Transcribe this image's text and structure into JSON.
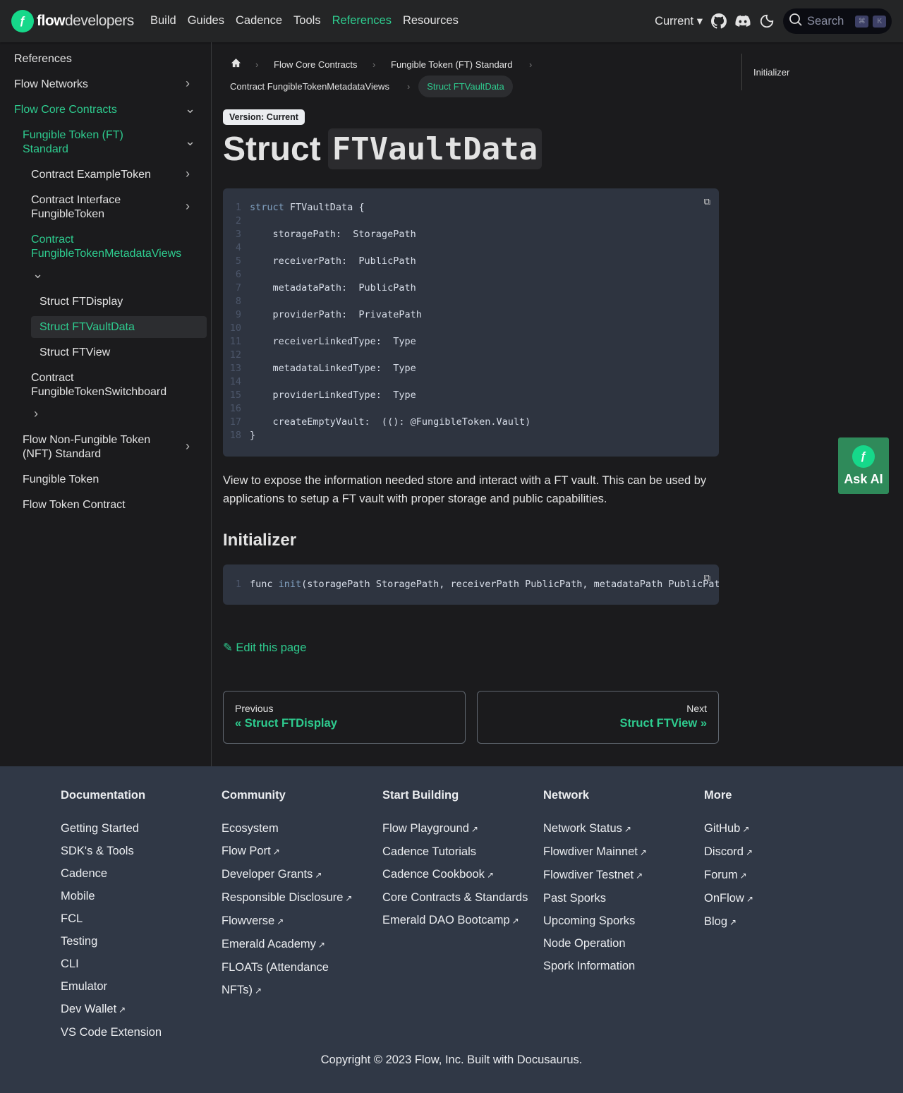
{
  "nav": {
    "logo_bold": "flow",
    "logo_rest": "developers",
    "links": [
      "Build",
      "Guides",
      "Cadence",
      "Tools",
      "References",
      "Resources"
    ],
    "active": "References",
    "version": "Current",
    "search_placeholder": "Search",
    "kbd1": "⌘",
    "kbd2": "K"
  },
  "sidebar": {
    "title": "References",
    "flow_networks": "Flow Networks",
    "flow_core": "Flow Core Contracts",
    "ft_standard": "Fungible Token (FT) Standard",
    "example_token": "Contract ExampleToken",
    "interface_ft": "Contract Interface FungibleToken",
    "ft_metadata": "Contract FungibleTokenMetadataViews",
    "ft_display": "Struct FTDisplay",
    "ft_vault_data": "Struct FTVaultData",
    "ft_view": "Struct FTView",
    "ft_switchboard": "Contract FungibleTokenSwitchboard",
    "nft_standard": "Flow Non-Fungible Token (NFT) Standard",
    "fungible_token": "Fungible Token",
    "flow_token": "Flow Token Contract"
  },
  "breadcrumb": [
    "Flow Core Contracts",
    "Fungible Token (FT) Standard",
    "Contract FungibleTokenMetadataViews",
    "Struct FTVaultData"
  ],
  "badge": "Version: Current",
  "title": {
    "prefix": "Struct",
    "code": "FTVaultData"
  },
  "code": [
    [
      "struct",
      " FTVaultData {"
    ],
    [
      "",
      ""
    ],
    [
      "",
      "    storagePath:  StoragePath"
    ],
    [
      "",
      ""
    ],
    [
      "",
      "    receiverPath:  PublicPath"
    ],
    [
      "",
      ""
    ],
    [
      "",
      "    metadataPath:  PublicPath"
    ],
    [
      "",
      ""
    ],
    [
      "",
      "    providerPath:  PrivatePath"
    ],
    [
      "",
      ""
    ],
    [
      "",
      "    receiverLinkedType:  Type"
    ],
    [
      "",
      ""
    ],
    [
      "",
      "    metadataLinkedType:  Type"
    ],
    [
      "",
      ""
    ],
    [
      "",
      "    providerLinkedType:  Type"
    ],
    [
      "",
      ""
    ],
    [
      "",
      "    createEmptyVault:  ((): @FungibleToken.Vault)"
    ],
    [
      "",
      "}"
    ]
  ],
  "description": "View to expose the information needed store and interact with a FT vault. This can be used by applications to setup a FT vault with proper storage and public capabilities.",
  "initializer": {
    "heading": "Initializer",
    "code_prefix": "func ",
    "code_fn": "init",
    "code_rest": "(storagePath StoragePath, receiverPath PublicPath, metadataPath PublicPath, providerPath PrivatePath"
  },
  "edit": "Edit this page",
  "pager": {
    "prev_sub": "Previous",
    "prev_label": "« Struct FTDisplay",
    "next_sub": "Next",
    "next_label": "Struct FTView »"
  },
  "toc": [
    "Initializer"
  ],
  "askai": "Ask AI",
  "footer": {
    "columns": [
      {
        "title": "Documentation",
        "items": [
          {
            "t": "Getting Started"
          },
          {
            "t": "SDK's & Tools"
          },
          {
            "t": "Cadence"
          },
          {
            "t": "Mobile"
          },
          {
            "t": "FCL"
          },
          {
            "t": "Testing"
          },
          {
            "t": "CLI"
          },
          {
            "t": "Emulator"
          },
          {
            "t": "Dev Wallet",
            "ext": true
          },
          {
            "t": "VS Code Extension"
          }
        ]
      },
      {
        "title": "Community",
        "items": [
          {
            "t": "Ecosystem"
          },
          {
            "t": "Flow Port",
            "ext": true
          },
          {
            "t": "Developer Grants",
            "ext": true
          },
          {
            "t": "Responsible Disclosure",
            "ext": true
          },
          {
            "t": "Flowverse",
            "ext": true
          },
          {
            "t": "Emerald Academy",
            "ext": true
          },
          {
            "t": "FLOATs (Attendance NFTs)",
            "ext": true
          }
        ]
      },
      {
        "title": "Start Building",
        "items": [
          {
            "t": "Flow Playground",
            "ext": true
          },
          {
            "t": "Cadence Tutorials"
          },
          {
            "t": "Cadence Cookbook",
            "ext": true
          },
          {
            "t": "Core Contracts & Standards"
          },
          {
            "t": "Emerald DAO Bootcamp",
            "ext": true
          }
        ]
      },
      {
        "title": "Network",
        "items": [
          {
            "t": "Network Status",
            "ext": true
          },
          {
            "t": "Flowdiver Mainnet",
            "ext": true
          },
          {
            "t": "Flowdiver Testnet",
            "ext": true
          },
          {
            "t": "Past Sporks"
          },
          {
            "t": "Upcoming Sporks"
          },
          {
            "t": "Node Operation"
          },
          {
            "t": "Spork Information"
          }
        ]
      },
      {
        "title": "More",
        "items": [
          {
            "t": "GitHub",
            "ext": true
          },
          {
            "t": "Discord",
            "ext": true
          },
          {
            "t": "Forum",
            "ext": true
          },
          {
            "t": "OnFlow",
            "ext": true
          },
          {
            "t": "Blog",
            "ext": true
          }
        ]
      }
    ],
    "copyright": "Copyright © 2023 Flow, Inc. Built with Docusaurus."
  },
  "colors": {
    "accent": "#2ecc8f",
    "footer_bg": "#303846",
    "code_bg": "#2e3440"
  }
}
